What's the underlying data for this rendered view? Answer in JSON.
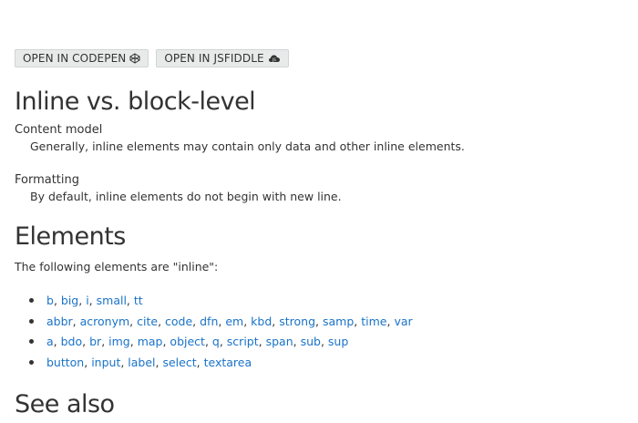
{
  "toolbar": {
    "codepen_label": "OPEN IN CODEPEN",
    "jsfiddle_label": "OPEN IN JSFIDDLE",
    "codepen_icon": "codepen-icon",
    "jsfiddle_icon": "jsfiddle-cloud-icon"
  },
  "sections": {
    "inline_vs_block": {
      "title": "Inline vs. block-level",
      "items": [
        {
          "term": "Content model",
          "definition": "Generally, inline elements may contain only data and other inline elements."
        },
        {
          "term": "Formatting",
          "definition": "By default, inline elements do not begin with new line."
        }
      ]
    },
    "elements": {
      "title": "Elements",
      "intro": "The following elements are \"inline\":",
      "rows": [
        [
          "b",
          "big",
          "i",
          "small",
          "tt"
        ],
        [
          "abbr",
          "acronym",
          "cite",
          "code",
          "dfn",
          "em",
          "kbd",
          "strong",
          "samp",
          "time",
          "var"
        ],
        [
          "a",
          "bdo",
          "br",
          "img",
          "map",
          "object",
          "q",
          "script",
          "span",
          "sub",
          "sup"
        ],
        [
          "button",
          "input",
          "label",
          "select",
          "textarea"
        ]
      ]
    },
    "see_also": {
      "title": "See also"
    }
  },
  "colors": {
    "link": "#1a73c8",
    "text": "#333333",
    "button_bg": "#e8eaea"
  }
}
